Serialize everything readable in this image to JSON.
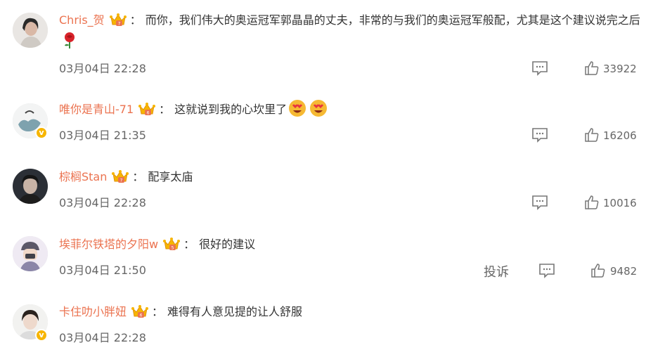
{
  "comments": [
    {
      "username": "Chris_贺",
      "text": "而你，我们伟大的奥运冠军郭晶晶的丈夫，非常的与我们的奥运冠军般配，尤其是这个建议说完之后",
      "time": "03月04日 22:28",
      "likes": "33922",
      "emojis": [
        "rose-emoji"
      ]
    },
    {
      "username": "唯你是青山-71",
      "text": "这就说到我的心坎里了",
      "time": "03月04日 21:35",
      "likes": "16206",
      "emojis": [
        "heart-eyes-emoji",
        "heart-eyes-emoji"
      ]
    },
    {
      "username": "棕榈Stan",
      "text": "配享太庙",
      "time": "03月04日 22:28",
      "likes": "10016",
      "emojis": []
    },
    {
      "username": "埃菲尔铁塔的夕阳w",
      "text": "很好的建议",
      "time": "03月04日 21:50",
      "likes": "9482",
      "report": "投诉",
      "emojis": []
    },
    {
      "username": "卡住叻小胖妞",
      "text": "难得有人意见提的让人舒服",
      "time": "03月04日 22:28",
      "emojis": []
    }
  ],
  "colon": "：",
  "colors": {
    "username": "#eb7350",
    "text": "#333333",
    "meta": "#666666",
    "vip": "#f7b500"
  },
  "icons": {
    "crown": "vip-crown-icon",
    "reply": "comment-reply-icon",
    "like": "thumbs-up-icon",
    "verified": "verified-badge-icon"
  }
}
